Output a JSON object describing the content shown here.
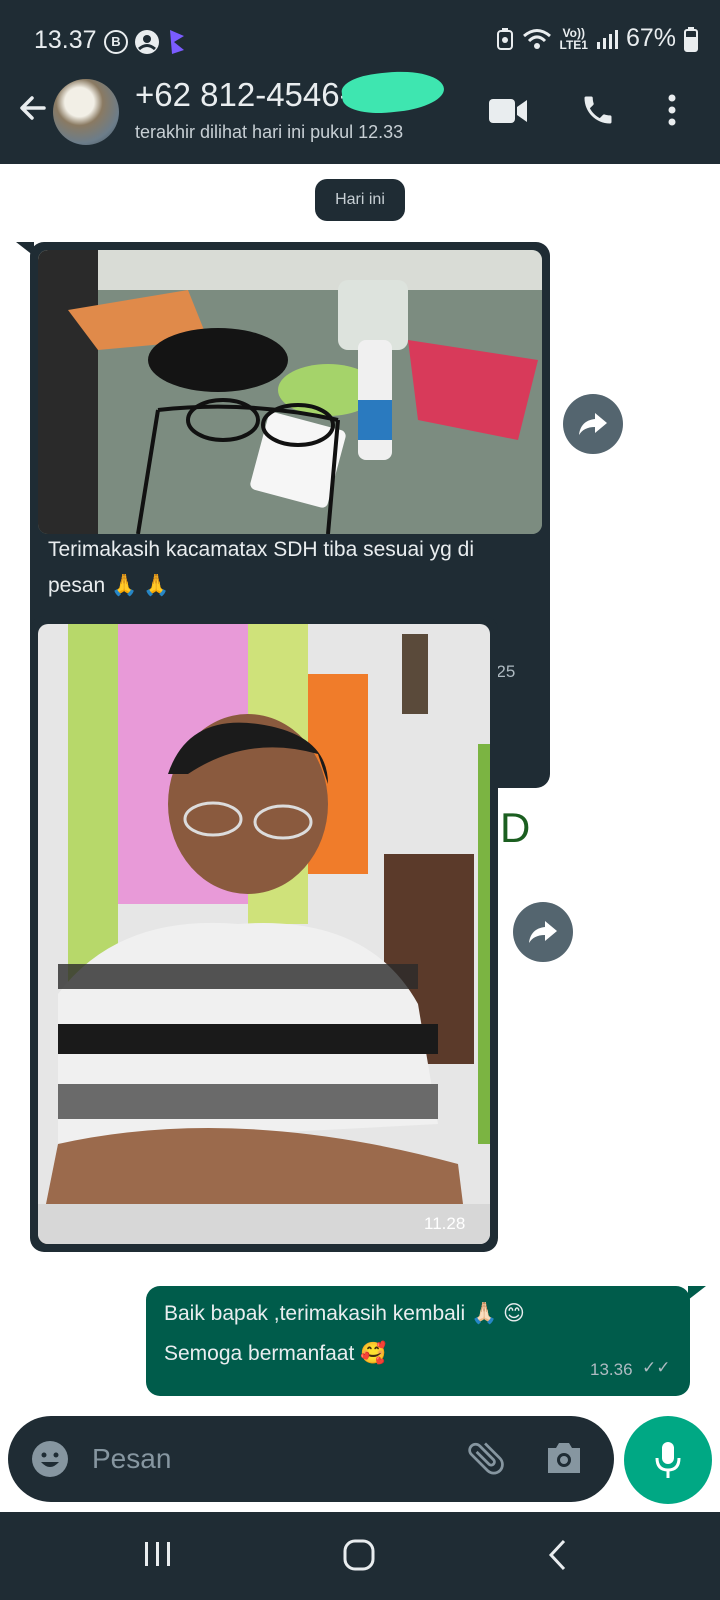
{
  "status_bar": {
    "time": "13.37",
    "battery": "67%",
    "network_label_top": "Vo))",
    "network_label_bottom": "LTE1"
  },
  "header": {
    "contact_name": "+62 812-4546-",
    "last_seen": "terakhir dilihat hari ini pukul 12.33"
  },
  "chat": {
    "date_chip": "Hari ini",
    "messages": [
      {
        "direction": "in",
        "type": "image",
        "caption": "Terimakasih kacamatax SDH tiba sesuai yg di pesan 🙏 🙏",
        "time": "11.25"
      },
      {
        "direction": "in",
        "type": "image",
        "caption": "",
        "time": "11.28"
      },
      {
        "direction": "out",
        "type": "text",
        "line1": "Baik bapak ,terimakasih kembali 🙏🏻 😊",
        "line2": "Semoga bermanfaat 🥰",
        "time": "13.36",
        "ticks": "✓✓"
      }
    ],
    "wallpaper_letter": "D"
  },
  "composer": {
    "placeholder": "Pesan"
  },
  "colors": {
    "header_bg": "#1f2c34",
    "incoming_bubble": "#1f2c34",
    "outgoing_bubble": "#005c4b",
    "accent": "#00a884"
  },
  "icons": [
    "back-arrow-icon",
    "video-call-icon",
    "phone-icon",
    "more-vert-icon",
    "forward-icon",
    "emoji-icon",
    "attach-icon",
    "camera-icon",
    "mic-icon",
    "recents-icon",
    "home-icon",
    "nav-back-icon"
  ]
}
